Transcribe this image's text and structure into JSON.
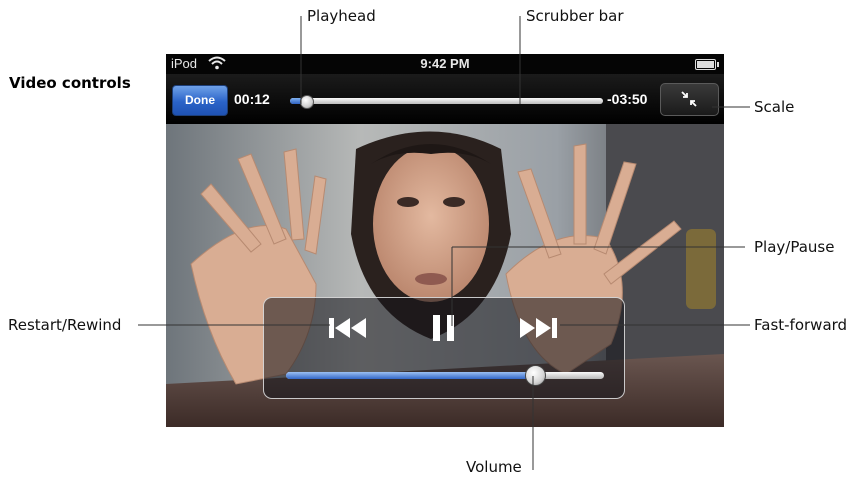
{
  "heading": "Video controls",
  "status_bar": {
    "carrier": "iPod",
    "time": "9:42 PM"
  },
  "nav_bar": {
    "done_label": "Done",
    "elapsed": "00:12",
    "remaining": "-03:50",
    "progress": 0.05
  },
  "hud": {
    "volume": 0.78
  },
  "callouts": {
    "playhead": "Playhead",
    "scrubber": "Scrubber bar",
    "scale": "Scale",
    "play_pause": "Play/Pause",
    "restart_rewind": "Restart/Rewind",
    "fast_forward": "Fast-forward",
    "volume": "Volume"
  },
  "colors": {
    "accent": "#2a63c8",
    "background": "#ffffff",
    "bar": "#000000"
  },
  "icons": [
    "wifi-icon",
    "battery-icon",
    "scale-icon",
    "rewind-icon",
    "pause-icon",
    "fast-forward-icon"
  ]
}
